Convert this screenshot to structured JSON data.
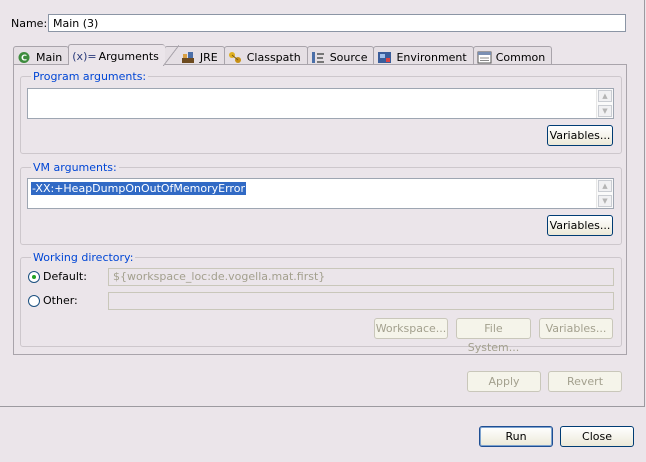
{
  "name": {
    "label": "Name:",
    "value": "Main (3)"
  },
  "tabs": [
    {
      "label": "Main",
      "icon": "main-tab-icon"
    },
    {
      "label": "Arguments",
      "prefix": "(x)=",
      "icon": "arguments-tab-icon"
    },
    {
      "label": "JRE",
      "icon": "jre-tab-icon"
    },
    {
      "label": "Classpath",
      "icon": "classpath-tab-icon"
    },
    {
      "label": "Source",
      "icon": "source-tab-icon"
    },
    {
      "label": "Environment",
      "icon": "environment-tab-icon"
    },
    {
      "label": "Common",
      "icon": "common-tab-icon"
    }
  ],
  "program_arguments": {
    "label": "Program arguments:",
    "value": "",
    "variables_label": "Variables..."
  },
  "vm_arguments": {
    "label": "VM arguments:",
    "value": "-XX:+HeapDumpOnOutOfMemoryError",
    "variables_label": "Variables..."
  },
  "working_directory": {
    "label": "Working directory:",
    "default_label": "Default:",
    "default_value": "${workspace_loc:de.vogella.mat.first}",
    "other_label": "Other:",
    "other_value": "",
    "workspace_label": "Workspace...",
    "filesystem_label": "File System...",
    "variables_label": "Variables..."
  },
  "apply_label": "Apply",
  "revert_label": "Revert",
  "run_label": "Run",
  "close_label": "Close",
  "colors": {
    "accent": "#0046d5",
    "background": "#ebe5ea",
    "selection": "#316ac5"
  }
}
